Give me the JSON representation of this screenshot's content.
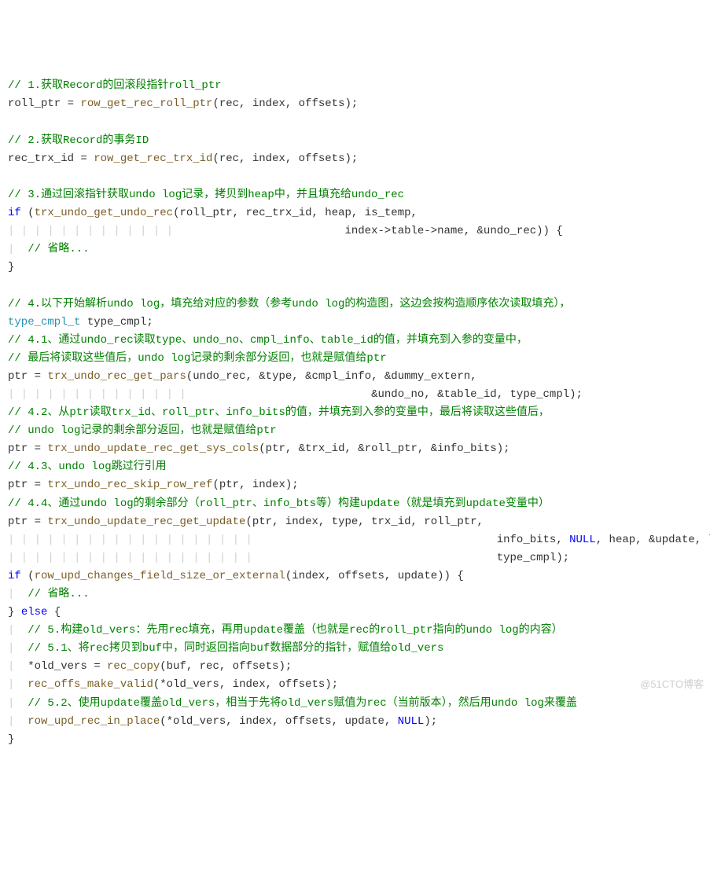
{
  "code": {
    "l1": "// 1.获取Record的回滚段指针roll_ptr",
    "l2a": "roll_ptr = ",
    "l2b": "row_get_rec_roll_ptr",
    "l2c": "(rec, index, offsets);",
    "l3": "",
    "l4": "// 2.获取Record的事务ID",
    "l5a": "rec_trx_id = ",
    "l5b": "row_get_rec_trx_id",
    "l5c": "(rec, index, offsets);",
    "l6": "",
    "l7": "// 3.通过回滚指针获取undo log记录，拷贝到heap中，并且填充给undo_rec",
    "l8a": "if",
    "l8b": " (",
    "l8c": "trx_undo_get_undo_rec",
    "l8d": "(roll_ptr, rec_trx_id, heap, is_temp,",
    "l9": "                          index->table->name, &undo_rec)) {",
    "l10a": "  ",
    "l10b": "// 省略...",
    "l11": "}",
    "l12": "",
    "l13": "// 4.以下开始解析undo log，填充给对应的参数（参考undo log的构造图，这边会按构造顺序依次读取填充），",
    "l14a": "type_cmpl_t",
    "l14b": " type_cmpl;",
    "l15": "// 4.1、通过undo_rec读取type、undo_no、cmpl_info、table_id的值，并填充到入参的变量中，",
    "l16": "// 最后将读取这些值后，undo log记录的剩余部分返回，也就是赋值给ptr",
    "l17a": "ptr = ",
    "l17b": "trx_undo_rec_get_pars",
    "l17c": "(undo_rec, &type, &cmpl_info, &dummy_extern,",
    "l18": "                            &undo_no, &table_id, type_cmpl);",
    "l19": "// 4.2、从ptr读取trx_id、roll_ptr、info_bits的值，并填充到入参的变量中，最后将读取这些值后，",
    "l20": "// undo log记录的剩余部分返回，也就是赋值给ptr",
    "l21a": "ptr = ",
    "l21b": "trx_undo_update_rec_get_sys_cols",
    "l21c": "(ptr, &trx_id, &roll_ptr, &info_bits);",
    "l22": "// 4.3、undo log跳过行引用",
    "l23a": "ptr = ",
    "l23b": "trx_undo_rec_skip_row_ref",
    "l23c": "(ptr, index);",
    "l24": "// 4.4、通过undo log的剩余部分（roll_ptr、info_bts等）构建update（就是填充到update变量中）",
    "l25a": "ptr = ",
    "l25b": "trx_undo_update_rec_get_update",
    "l25c": "(ptr, index, type, trx_id, roll_ptr,",
    "l26a": "                                     info_bits, ",
    "l26b": "NULL",
    "l26c": ", heap, &update, lob_undo,",
    "l27": "                                     type_cmpl);",
    "l28a": "if",
    "l28b": " (",
    "l28c": "row_upd_changes_field_size_or_external",
    "l28d": "(index, offsets, update)) {",
    "l29a": "  ",
    "l29b": "// 省略...",
    "l30a": "} ",
    "l30b": "else",
    "l30c": " {",
    "l31a": "  ",
    "l31b": "// 5.构建old_vers：先用rec填充，再用update覆盖（也就是rec的roll_ptr指向的undo log的内容）",
    "l32a": "  ",
    "l32b": "// 5.1、将rec拷贝到buf中，同时返回指向buf数据部分的指针，赋值给old_vers",
    "l33a": "  *old_vers = ",
    "l33b": "rec_copy",
    "l33c": "(buf, rec, offsets);",
    "l34a": "  ",
    "l34b": "rec_offs_make_valid",
    "l34c": "(*old_vers, index, offsets);",
    "l35a": "  ",
    "l35b": "// 5.2、使用update覆盖old_vers，相当于先将old_vers赋值为rec（当前版本），然后用undo log来覆盖",
    "l36a": "  ",
    "l36b": "row_upd_rec_in_place",
    "l36c": "(*old_vers, index, offsets, update, ",
    "l36d": "NULL",
    "l36e": ");",
    "l37": "}"
  },
  "watermark": "@51CTO博客"
}
